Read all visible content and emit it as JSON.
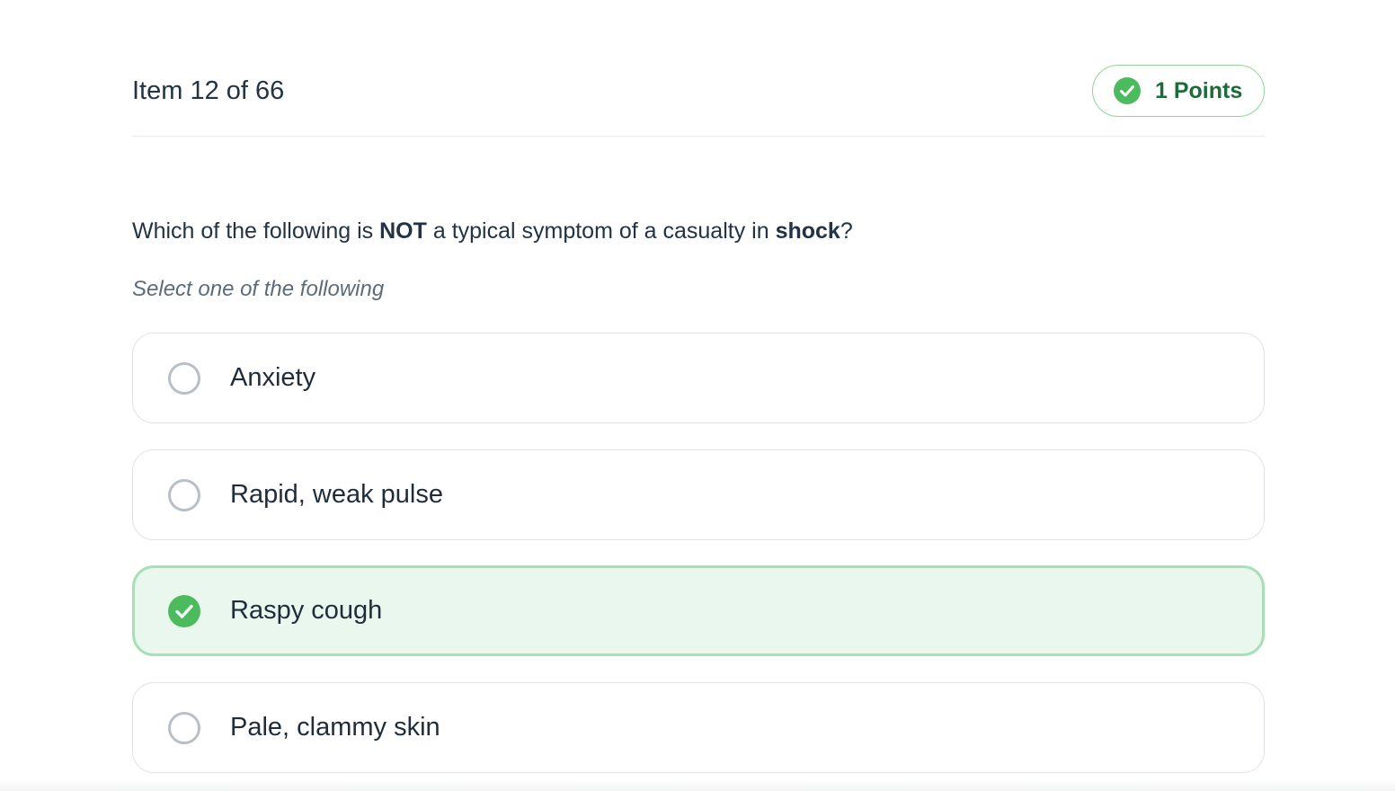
{
  "header": {
    "item_counter": "Item 12 of 66",
    "points_label": "1 Points",
    "points_icon": "check-circle-icon"
  },
  "question": {
    "part1": "Which of the following is ",
    "bold1": "NOT",
    "part2": " a typical symptom of a casualty in ",
    "bold2": "shock",
    "part3": "?"
  },
  "instruction": "Select one of the following",
  "options": [
    {
      "label": "Anxiety",
      "selected": false
    },
    {
      "label": "Rapid, weak pulse",
      "selected": false
    },
    {
      "label": "Raspy cough",
      "selected": true
    },
    {
      "label": "Pale, clammy skin",
      "selected": false
    }
  ],
  "colors": {
    "accent_green": "#4cbb5e",
    "selected_bg": "#eaf7ee",
    "selected_border": "#a6e0b4",
    "points_text": "#1c6b3a"
  }
}
